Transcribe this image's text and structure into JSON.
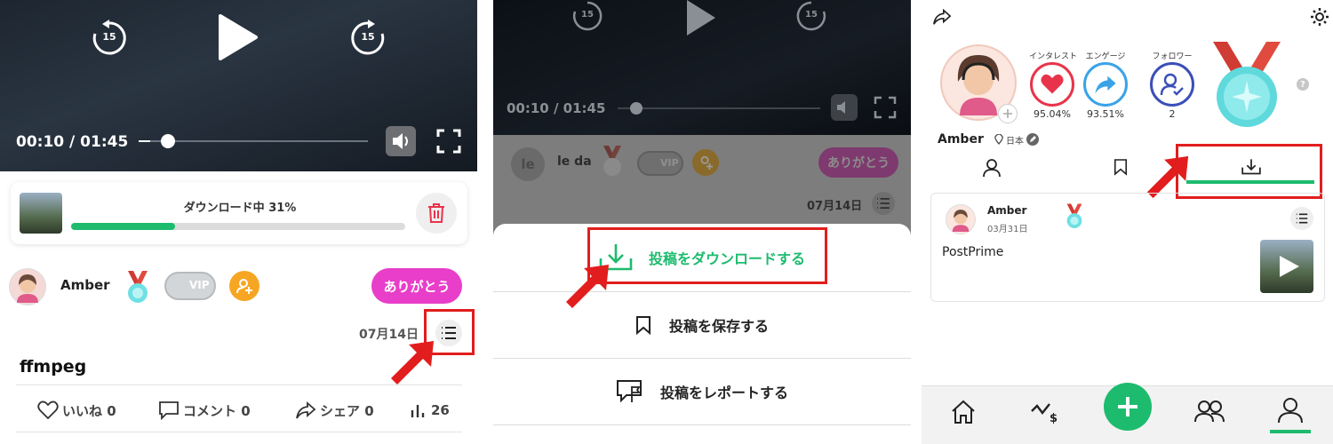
{
  "panel1": {
    "video": {
      "rewind_label": "15",
      "forward_label": "15",
      "time": "00:10 / 01:45",
      "progress_fraction": 0.05
    },
    "download": {
      "status": "ダウンロード中  31%",
      "progress_fraction": 0.31
    },
    "post": {
      "author": "Amber",
      "vip_label": "VIP",
      "thanks_button": "ありがとう",
      "date": "07月14日",
      "title": "ffmpeg",
      "actions": {
        "like": "いいね 0",
        "comment": "コメント 0",
        "share": "シェア 0",
        "views": "26"
      }
    }
  },
  "panel2": {
    "video": {
      "rewind_label": "15",
      "forward_label": "15",
      "time": "00:10 / 01:45"
    },
    "post": {
      "author": "le da",
      "avatar_initials": "le",
      "vip_label": "VIP",
      "thanks_button": "ありがとう",
      "date": "07月14日"
    },
    "menu": {
      "download": "投稿をダウンロードする",
      "save": "投稿を保存する",
      "report": "投稿をレポートする"
    }
  },
  "panel3": {
    "profile": {
      "name": "Amber",
      "location": "日本",
      "stats": [
        {
          "label": "インタレスト",
          "value": "95.04%"
        },
        {
          "label": "エンゲージ",
          "value": "93.51%"
        },
        {
          "label": "フォロワー",
          "value": "2"
        }
      ],
      "help_glyph": "?"
    },
    "post": {
      "author": "Amber",
      "date": "03月31日",
      "body": "PostPrime"
    }
  },
  "colors": {
    "brand_green": "#1dbb6e",
    "thanks_pink": "#e83ec9",
    "highlight_red": "#e21d1d",
    "heart_red": "#e8344a",
    "engage_blue": "#3aa3e8",
    "follower_blue": "#3b4fb8"
  }
}
